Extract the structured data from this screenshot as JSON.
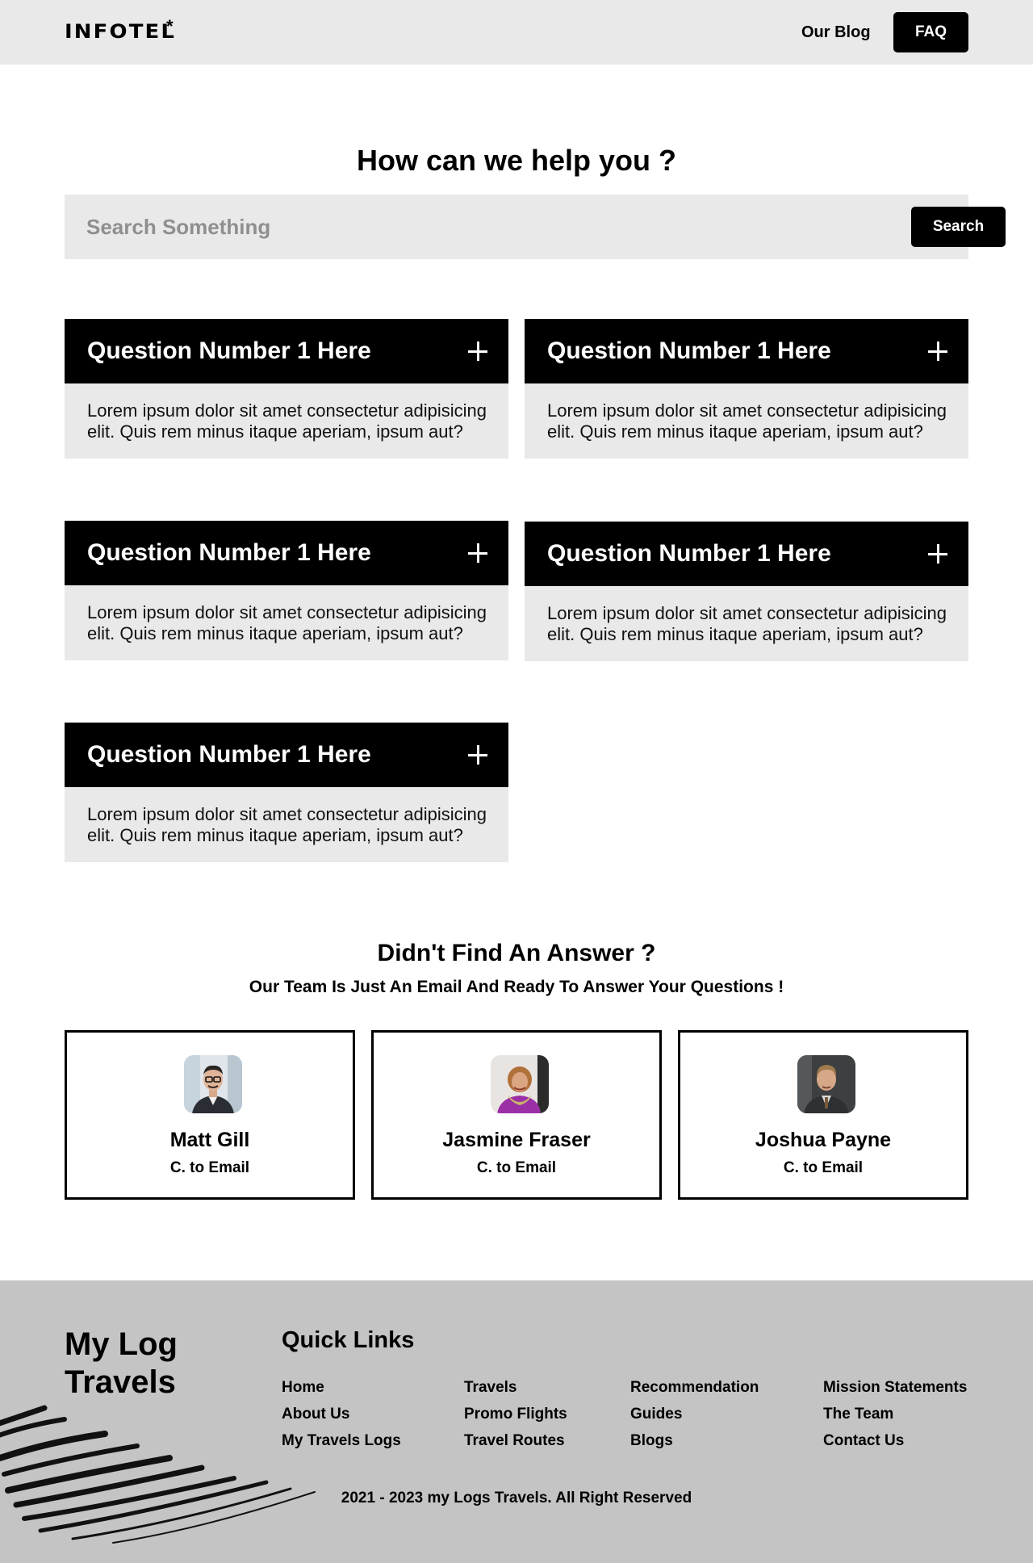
{
  "header": {
    "logo": "INFOTEL",
    "logo_mark": "*",
    "nav_blog": "Our Blog",
    "nav_faq": "FAQ"
  },
  "help": {
    "title": "How can we help you ?",
    "search_placeholder": "Search Something",
    "search_button": "Search"
  },
  "faqs": [
    {
      "question": "Question Number 1 Here",
      "answer": "Lorem ipsum dolor sit amet consectetur adipisicing elit. Quis rem minus itaque aperiam, ipsum aut?"
    },
    {
      "question": "Question Number 1 Here",
      "answer": "Lorem ipsum dolor sit amet consectetur adipisicing elit. Quis rem minus itaque aperiam, ipsum aut?"
    },
    {
      "question": "Question Number 1 Here",
      "answer": "Lorem ipsum dolor sit amet consectetur adipisicing elit. Quis rem minus itaque aperiam, ipsum aut?"
    },
    {
      "question": "Question Number 1 Here",
      "answer": "Lorem ipsum dolor sit amet consectetur adipisicing elit. Quis rem minus itaque aperiam, ipsum aut?"
    },
    {
      "question": "Question Number 1 Here",
      "answer": "Lorem ipsum dolor sit amet consectetur adipisicing elit. Quis rem minus itaque aperiam, ipsum aut?"
    }
  ],
  "faq_icon": "plus-icon",
  "contact": {
    "title": "Didn't Find An Answer ?",
    "subtitle": "Our Team Is Just An Email And Ready To Answer Your Questions !",
    "people": [
      {
        "name": "Matt Gill",
        "email_label": "C. to Email"
      },
      {
        "name": "Jasmine Fraser",
        "email_label": "C. to Email"
      },
      {
        "name": "Joshua Payne",
        "email_label": "C. to Email"
      }
    ]
  },
  "footer": {
    "brand": "My Log Travels",
    "quick_links_title": "Quick Links",
    "columns": [
      [
        "Home",
        "About Us",
        "My Travels Logs"
      ],
      [
        "Travels",
        "Promo Flights",
        "Travel Routes"
      ],
      [
        "Recommendation",
        "Guides",
        "Blogs"
      ],
      [
        "Mission Statements",
        "The Team",
        "Contact Us"
      ]
    ],
    "copyright": "2021 - 2023 my Logs Travels. All Right Reserved"
  },
  "colors": {
    "header_bg": "#e9e9e9",
    "accent": "#000000",
    "footer_bg": "#c4c4c4"
  }
}
